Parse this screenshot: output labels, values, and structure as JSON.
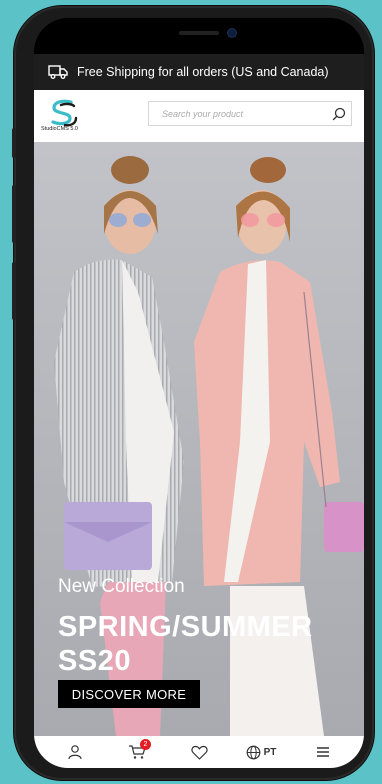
{
  "shipping_bar": {
    "text": "Free Shipping for all orders (US and Canada)",
    "icon": "truck-icon"
  },
  "header": {
    "logo_text": "StudioCMS 5.0",
    "search_placeholder": "Search your product",
    "search_icon": "search-icon"
  },
  "hero": {
    "subtitle": "New Collection",
    "title_line1": "SPRING/SUMMER",
    "title_line2": "SS20",
    "cta_label": "DISCOVER MORE"
  },
  "tabbar": {
    "items": [
      {
        "icon": "user-icon"
      },
      {
        "icon": "cart-icon",
        "badge": "2"
      },
      {
        "icon": "heart-icon"
      },
      {
        "icon": "globe-icon",
        "label": "PT"
      },
      {
        "icon": "menu-icon"
      }
    ]
  },
  "colors": {
    "background": "#5bc3c7",
    "accent_badge": "#e31c23",
    "cta": "#000000"
  }
}
